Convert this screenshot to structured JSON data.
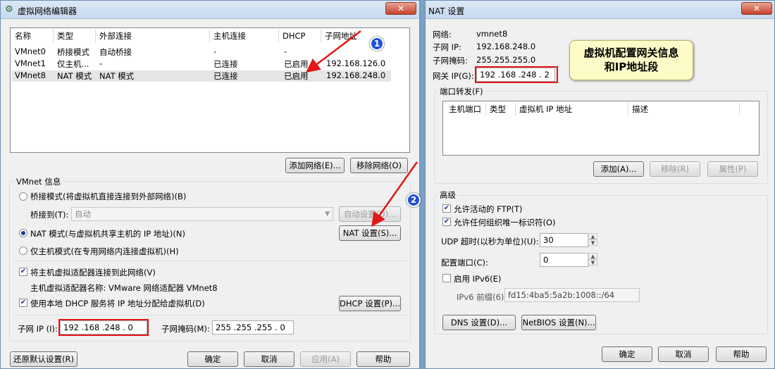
{
  "left": {
    "title": "虚拟网络编辑器",
    "close": "✕",
    "table": {
      "headers": [
        "名称",
        "类型",
        "外部连接",
        "主机连接",
        "DHCP",
        "子网地址"
      ],
      "rows": [
        [
          "VMnet0",
          "桥接模式",
          "自动桥接",
          "-",
          "-",
          ""
        ],
        [
          "VMnet1",
          "仅主机...",
          "-",
          "已连接",
          "已启用",
          "192.168.126.0"
        ],
        [
          "VMnet8",
          "NAT 模式",
          "NAT 模式",
          "已连接",
          "已启用",
          "192.168.248.0"
        ]
      ]
    },
    "add_network": "添加网络(E)...",
    "remove_network": "移除网络(O)",
    "vmnet_info": "VMnet 信息",
    "bridge_radio": "桥接模式(将虚拟机直接连接到外部网络)(B)",
    "bridge_to_label": "桥接到(T):",
    "bridge_to_value": "自动",
    "auto_settings": "自动设置(U)...",
    "nat_radio": "NAT 模式(与虚拟机共享主机的 IP 地址)(N)",
    "nat_settings": "NAT 设置(S)...",
    "hostonly_radio": "仅主机模式(在专用网络内连接虚拟机)(H)",
    "connect_adapter": "将主机虚拟适配器连接到此网络(V)",
    "adapter_name": "主机虚拟适配器名称: VMware 网络适配器 VMnet8",
    "use_dhcp": "使用本地 DHCP 服务将 IP 地址分配给虚拟机(D)",
    "dhcp_settings": "DHCP 设置(P)...",
    "subnet_ip_label": "子网 IP (I):",
    "subnet_ip_value": "192 .168 .248 .  0",
    "subnet_mask_label": "子网掩码(M):",
    "subnet_mask_value": "255 .255 .255 .  0",
    "restore_defaults": "还原默认设置(R)",
    "ok": "确定",
    "cancel": "取消",
    "apply": "应用(A)",
    "help": "帮助"
  },
  "right": {
    "title": "NAT 设置",
    "close": "✕",
    "network_label": "网络:",
    "network_value": "vmnet8",
    "subnet_ip_label": "子网 IP:",
    "subnet_ip_value": "192.168.248.0",
    "subnet_mask_label": "子网掩码:",
    "subnet_mask_value": "255.255.255.0",
    "gateway_label": "网关 IP(G):",
    "gateway_value": "192 .168 .248 .  2",
    "port_forwarding": "端口转发(F)",
    "pf_headers": [
      "主机端口",
      "类型",
      "虚拟机 IP 地址",
      "描述"
    ],
    "pf_add": "添加(A)...",
    "pf_remove": "移除(R)",
    "pf_properties": "属性(P)",
    "advanced": "高级",
    "allow_ftp": "允许活动的 FTP(T)",
    "allow_uid": "允许任何组织唯一标识符(O)",
    "udp_label": "UDP 超时(以秒为单位)(U):",
    "udp_value": "30",
    "config_port_label": "配置端口(C):",
    "config_port_value": "0",
    "enable_ipv6": "启用 IPv6(E)",
    "ipv6_prefix_label": "IPv6 前缀(6):",
    "ipv6_prefix_value": "fd15:4ba5:5a2b:1008::/64",
    "dns_settings": "DNS 设置(D)...",
    "netbios_settings": "NetBIOS 设置(N)...",
    "ok": "确定",
    "cancel": "取消",
    "help": "帮助"
  },
  "annotations": {
    "badge1": "1",
    "badge2": "2",
    "note": "虚拟机配置网关信息\n和IP地址段"
  }
}
